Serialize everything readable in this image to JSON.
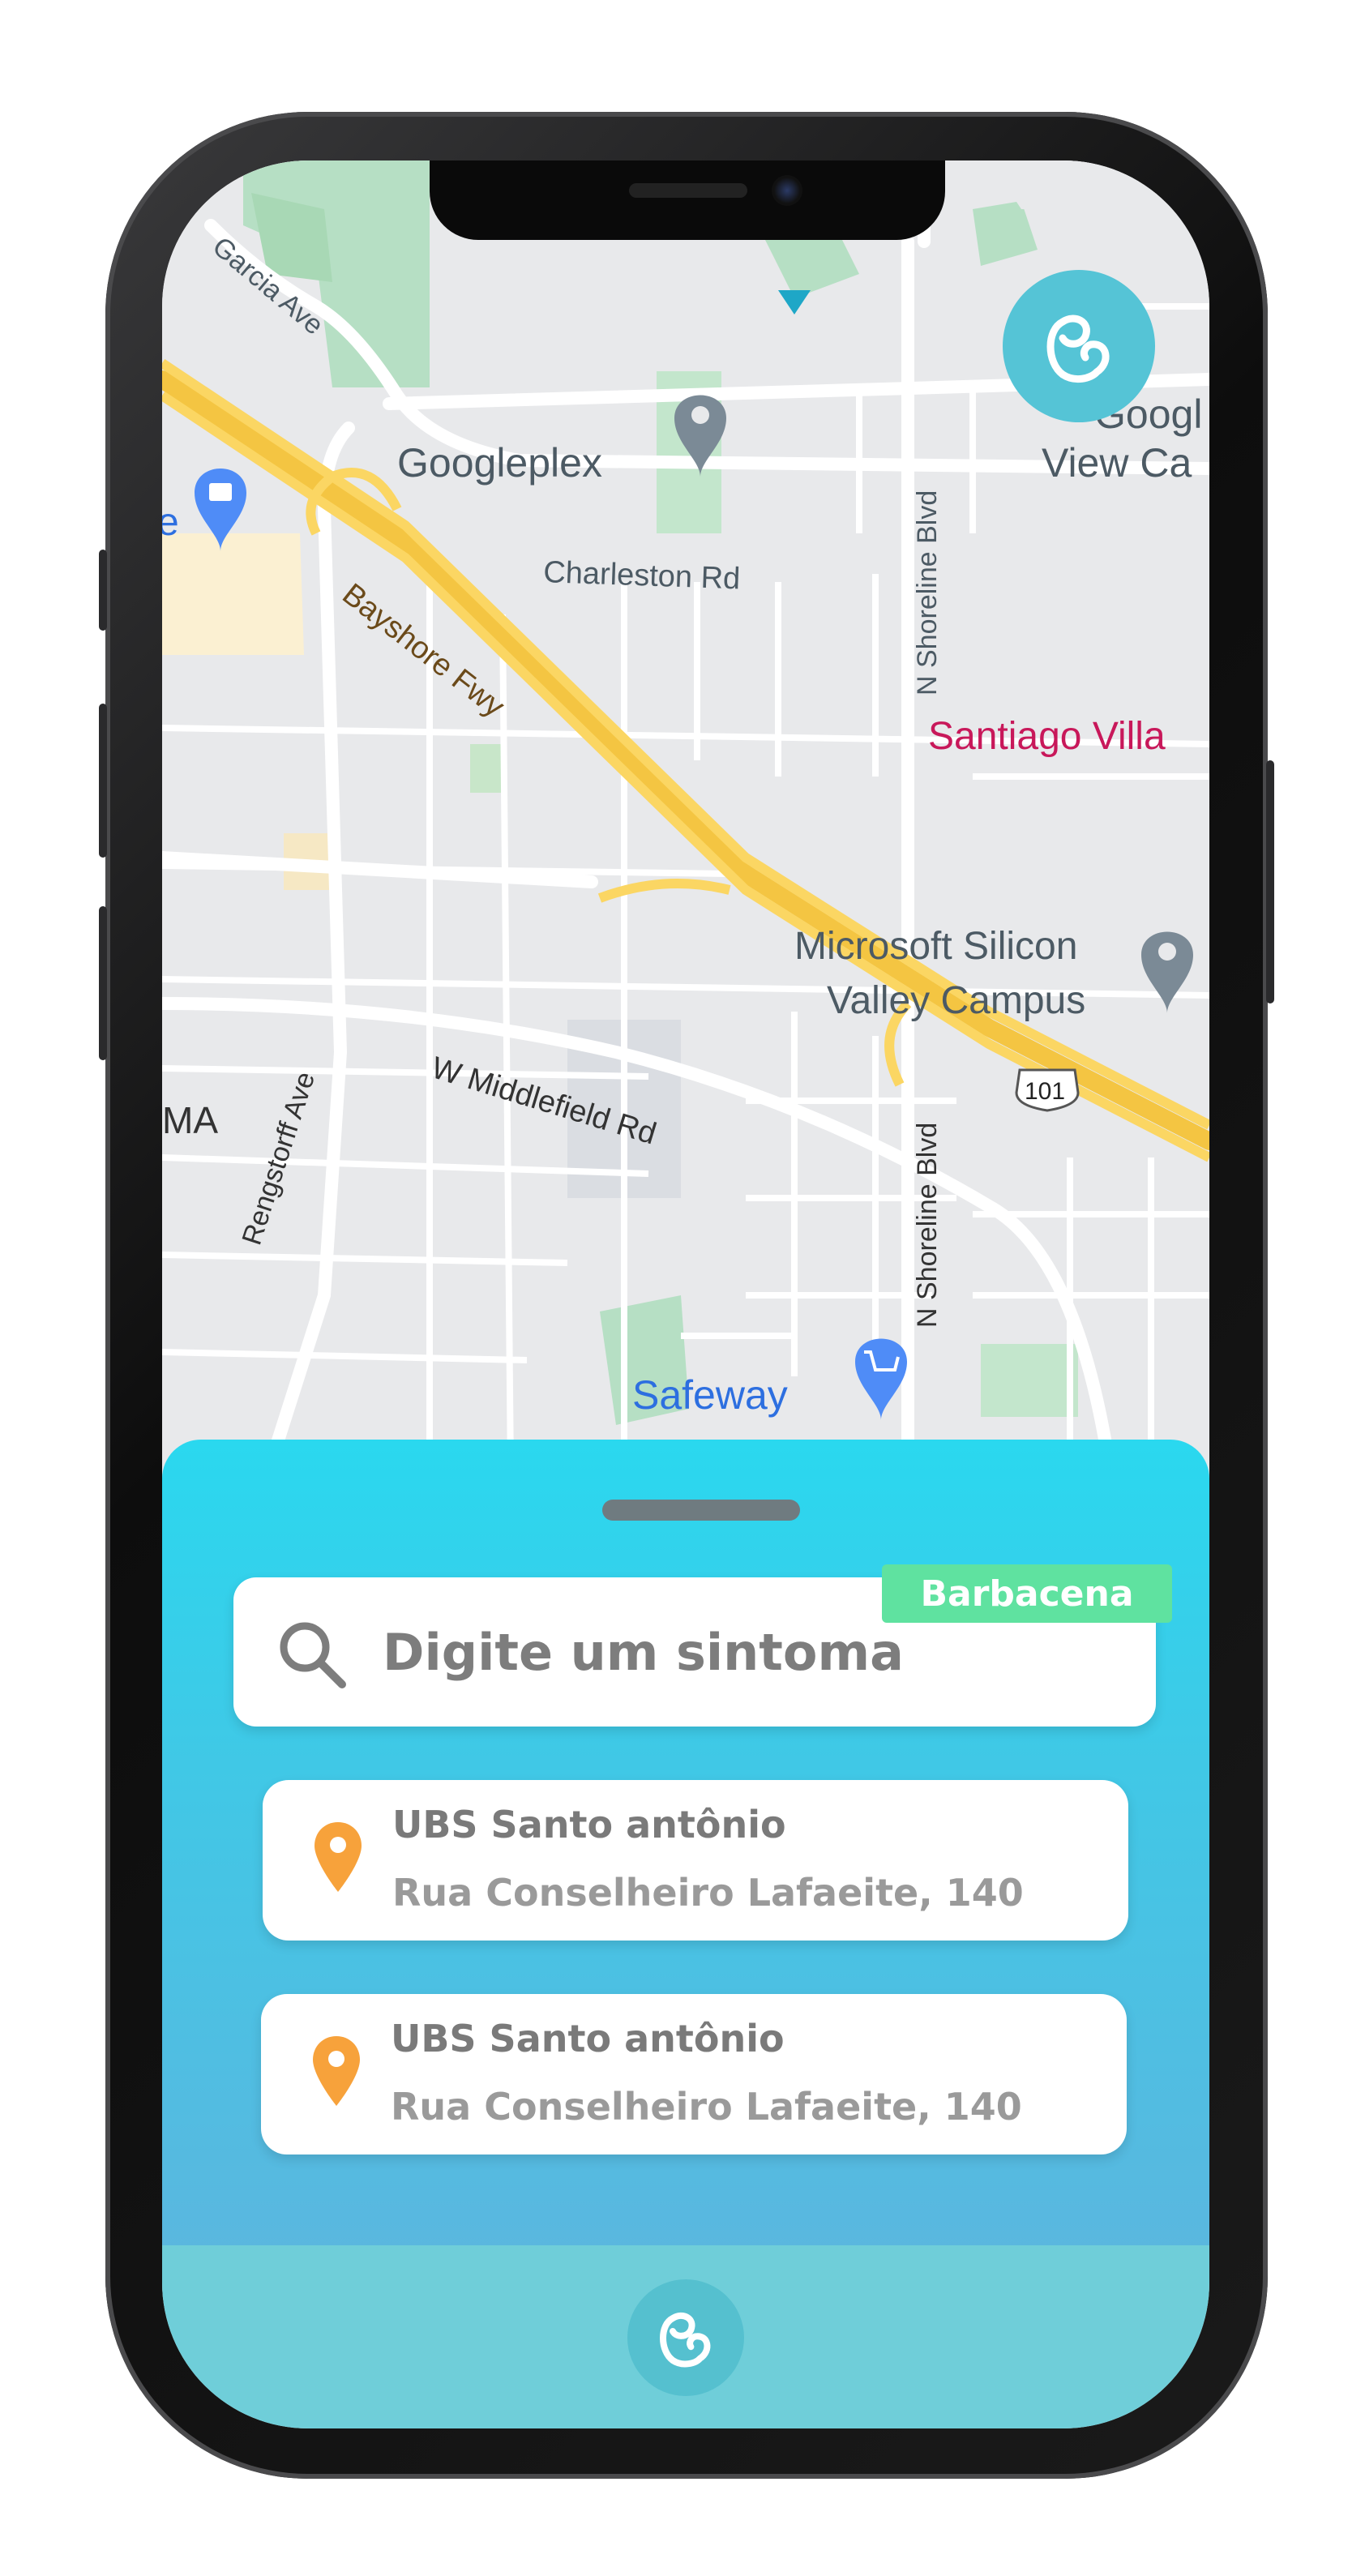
{
  "map": {
    "labels": {
      "garcia_ave": "Garcia Ave",
      "googleplex": "Googleplex",
      "google_view_line1": "Googl",
      "google_view_line2": "View Ca",
      "charleston_rd": "Charleston Rd",
      "bayshore_fwy": "Bayshore Fwy",
      "n_shoreline_blvd_top": "N Shoreline Blvd",
      "santiago_villa": "Santiago Villa",
      "microsoft_line1": "Microsoft Silicon",
      "microsoft_line2": "Valley Campus",
      "route_101": "101",
      "w_middlefield_rd": "W Middlefield Rd",
      "rengstorff_ave": "Rengstorff Ave",
      "ma": "MA",
      "n_shoreline_blvd_bottom": "N Shoreline Blvd",
      "safeway": "Safeway",
      "edge_e": "e"
    }
  },
  "search": {
    "placeholder": "Digite um sintoma",
    "city": "Barbacena"
  },
  "results": [
    {
      "name": "UBS Santo antônio",
      "address": "Rua Conselheiro Lafaeite, 140"
    },
    {
      "name": "UBS Santo antônio",
      "address": "Rua Conselheiro Lafaeite, 140"
    }
  ],
  "colors": {
    "sheet_top": "#2ad8ef",
    "sheet_bottom": "#5ab7df",
    "tabbar": "#6fced9",
    "badge": "#5fe2a0",
    "pin": "#f7a23b",
    "logo": "#55c4d6"
  },
  "icons": {
    "search": "search-icon",
    "pin": "location-pin-icon",
    "logo": "app-logo-icon"
  }
}
